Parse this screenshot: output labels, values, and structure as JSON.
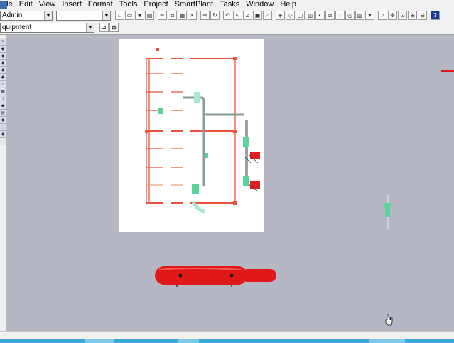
{
  "menu": {
    "items": [
      "File",
      "Edit",
      "View",
      "Insert",
      "Format",
      "Tools",
      "Project",
      "SmartPlant",
      "Tasks",
      "Window",
      "Help"
    ]
  },
  "toolbar": {
    "workspace_combo_value": "Admin",
    "second_combo_value": "",
    "filter_combo_value": "quipment"
  },
  "colors": {
    "viewport_bg": "#b5b8c4",
    "structure": "#e8533a",
    "vessel": "#e01818",
    "equipment_green": "#5bd39a"
  },
  "icons": [
    "new-icon",
    "open-icon",
    "save-icon",
    "print-icon",
    "cut-icon",
    "copy-icon",
    "paste-icon",
    "delete-icon",
    "undo-icon",
    "redo-icon",
    "select-icon",
    "zoom-icon",
    "pan-icon",
    "rotate-icon",
    "help-icon"
  ]
}
